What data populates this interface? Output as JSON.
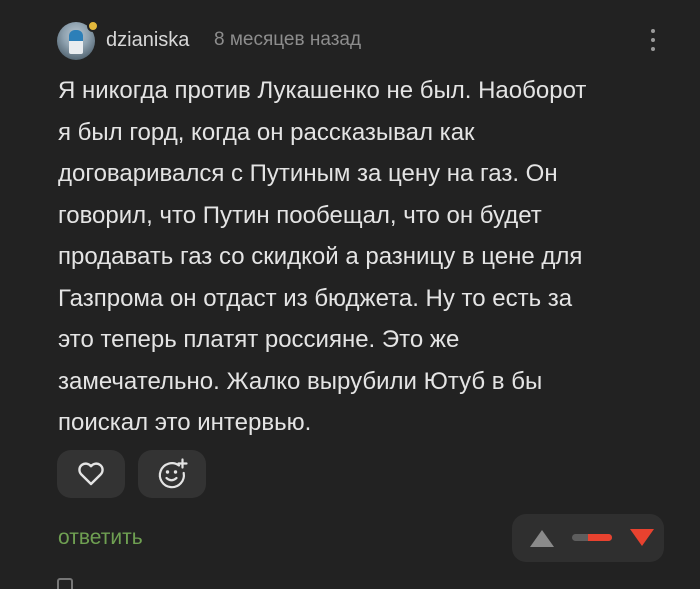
{
  "comment": {
    "author": "dzianiska",
    "timestamp": "8 месяцев назад",
    "text": "Я никогда против Лукашенко не был. Наоборот\nя был горд, когда он рассказывал как\nдоговаривался с Путиным за цену на газ. Он\nговорил, что Путин пообещал, что он будет\nпродавать газ со скидкой а разницу в цене для\nГазпрома он отдаст из бюджета. Ну то есть за\nэто теперь платят россияне. Это же\nзамечательно. Жалко вырубили Ютуб в бы\nпоискал это интервью.",
    "reply_label": "ответить"
  },
  "icons": {
    "avatar": "avatar",
    "status": "status-dot",
    "more": "more-vertical-icon",
    "like": "heart-icon",
    "emoji": "add-emoji-icon",
    "upvote": "arrow-up-icon",
    "downvote": "arrow-down-icon"
  },
  "rating": {
    "positive_share": 0.4
  },
  "colors": {
    "background": "#222222",
    "text": "#e4e4e4",
    "muted": "#8d8d8d",
    "reply": "#6fa052",
    "downvote": "#e8422f",
    "upvote": "#8a8a8a",
    "status": "#e3b83c"
  }
}
